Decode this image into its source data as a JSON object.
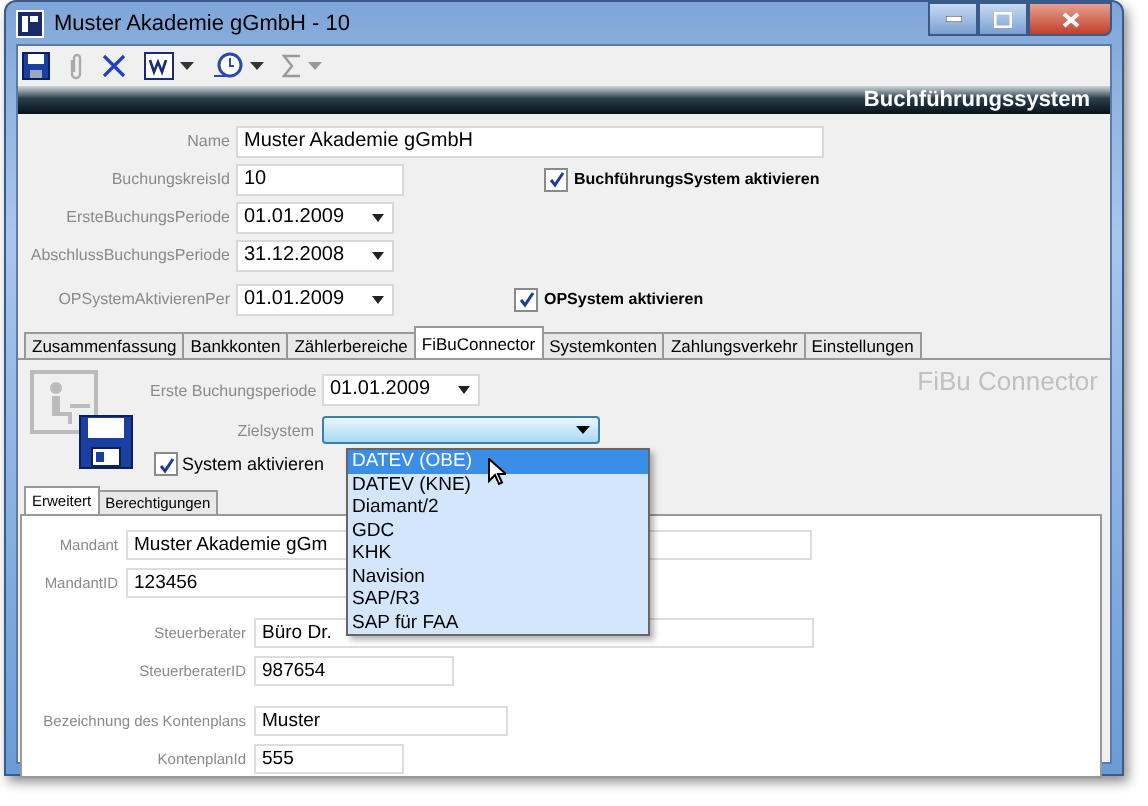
{
  "window": {
    "title": "Muster Akademie gGmbH - 10"
  },
  "banner": {
    "title": "Buchführungssystem"
  },
  "fields": [
    {
      "label": "Name",
      "value": "Muster Akademie gGmbH",
      "kind": "text"
    },
    {
      "label": "BuchungskreisId",
      "value": "10",
      "kind": "text",
      "checkbox": {
        "label": "BuchführungsSystem aktivieren",
        "checked": true
      }
    },
    {
      "label": "ErsteBuchungsPeriode",
      "value": "01.01.2009",
      "kind": "date"
    },
    {
      "label": "AbschlussBuchungsPeriode",
      "value": "31.12.2008",
      "kind": "date"
    },
    {
      "label": "OPSystemAktivierenPer",
      "value": "01.01.2009",
      "kind": "date",
      "checkbox": {
        "label": "OPSystem aktivieren",
        "checked": true
      }
    }
  ],
  "tabs": [
    {
      "label": "Zusammenfassung",
      "selected": false
    },
    {
      "label": "Bankkonten",
      "selected": false
    },
    {
      "label": "Zählerbereiche",
      "selected": false
    },
    {
      "label": "FiBuConnector",
      "selected": true
    },
    {
      "label": "Systemkonten",
      "selected": false
    },
    {
      "label": "Zahlungsverkehr",
      "selected": false
    },
    {
      "label": "Einstellungen",
      "selected": false
    }
  ],
  "panel": {
    "title": "FiBu Connector",
    "erste_buchungsperiode": {
      "label": "Erste Buchungsperiode",
      "value": "01.01.2009"
    },
    "zielsystem": {
      "label": "Zielsystem"
    },
    "system_checkbox": {
      "label": "System aktivieren",
      "checked": true
    },
    "dropdown_options": [
      {
        "label": "DATEV (OBE)",
        "selected": true
      },
      {
        "label": "DATEV (KNE)",
        "selected": false
      },
      {
        "label": "Diamant/2",
        "selected": false
      },
      {
        "label": "GDC",
        "selected": false
      },
      {
        "label": "KHK",
        "selected": false
      },
      {
        "label": "Navision",
        "selected": false
      },
      {
        "label": "SAP/R3",
        "selected": false
      },
      {
        "label": "SAP für FAA",
        "selected": false
      }
    ],
    "subtabs": [
      {
        "label": "Erweitert",
        "selected": true
      },
      {
        "label": "Berechtigungen",
        "selected": false
      }
    ],
    "subfields": [
      {
        "label": "Mandant",
        "value": "Muster Akademie gGm"
      },
      {
        "label": "MandantID",
        "value": "123456"
      },
      {
        "label": "Steuerberater",
        "value": "Büro Dr."
      },
      {
        "label": "SteuerberaterID",
        "value": "987654"
      },
      {
        "label": "Bezeichnung des Kontenplans",
        "value": "Muster"
      },
      {
        "label": "KontenplanId",
        "value": "555"
      }
    ]
  }
}
